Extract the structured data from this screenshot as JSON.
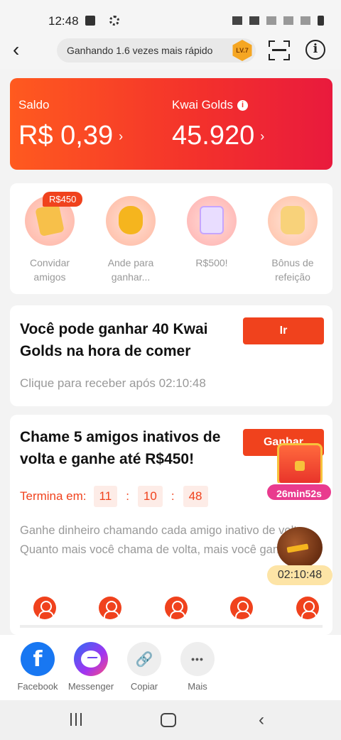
{
  "status_bar": {
    "time": "12:48"
  },
  "header": {
    "speed_text": "Ganhando 1.6 vezes mais rápido",
    "level_badge": "LV.7",
    "back_glyph": "‹",
    "info_glyph": "i"
  },
  "balance": {
    "saldo_label": "Saldo",
    "saldo_value": "R$ 0,39",
    "golds_label": "Kwai Golds",
    "golds_value": "45.920",
    "arrow_glyph": "›",
    "info_glyph": "i"
  },
  "shortcuts": {
    "items": [
      {
        "label": "Convidar amigos",
        "badge": "R$450",
        "icon": "invite-envelope-icon"
      },
      {
        "label": "Ande para ganhar...",
        "icon": "walking-man-icon"
      },
      {
        "label": "R$500!",
        "icon": "coin-checklist-icon"
      },
      {
        "label": "Bônus de refeição",
        "icon": "meal-bonus-icon"
      }
    ]
  },
  "meal_card": {
    "title": "Você pode ganhar 40 Kwai Golds na hora de comer",
    "button": "Ir",
    "subtitle": "Clique para receber após 02:10:48"
  },
  "friends_card": {
    "title": "Chame 5 amigos inativos de volta e ganhe até R$450!",
    "button": "Ganhar",
    "countdown_label": "Termina em:",
    "hours": "11",
    "minutes": "10",
    "seconds": "48",
    "separator": ":",
    "description": "Ganhe dinheiro chamando cada amigo inativo de volta. Quanto mais você chama de volta, mais você ganha."
  },
  "floating": {
    "chest_timer": "26min52s",
    "food_timer": "02:10:48"
  },
  "share": {
    "items": [
      {
        "label": "Facebook",
        "glyph": "f"
      },
      {
        "label": "Messenger"
      },
      {
        "label": "Copiar",
        "glyph": "🔗"
      },
      {
        "label": "Mais",
        "glyph": "•••"
      }
    ]
  },
  "colors": {
    "accent": "#f0421d",
    "banner_start": "#ff5a1f",
    "banner_end": "#e91a3d",
    "facebook": "#1877f2"
  }
}
